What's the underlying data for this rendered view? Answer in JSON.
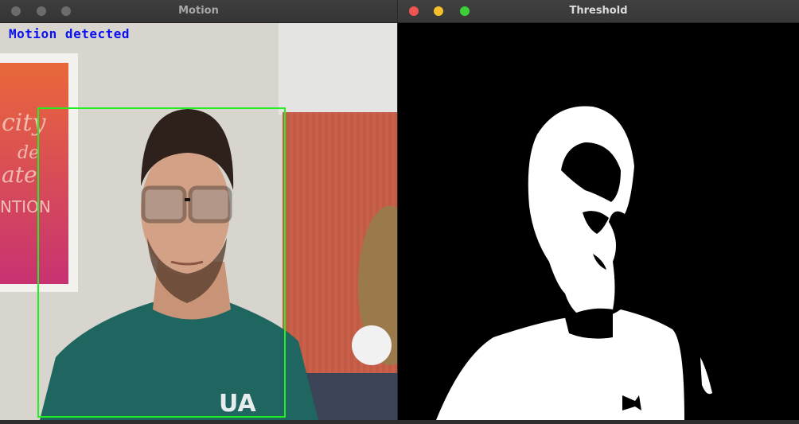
{
  "windows": {
    "motion": {
      "title": "Motion",
      "overlay_text": "Motion detected",
      "box_color": "#22ee22",
      "overlay_color": "#0a10f0",
      "shirt_logo": "UA"
    },
    "threshold": {
      "title": "Threshold",
      "controls": {
        "close_color": "#f05450",
        "minimize_color": "#f5c02b",
        "maximize_color": "#3ccf38"
      }
    }
  }
}
